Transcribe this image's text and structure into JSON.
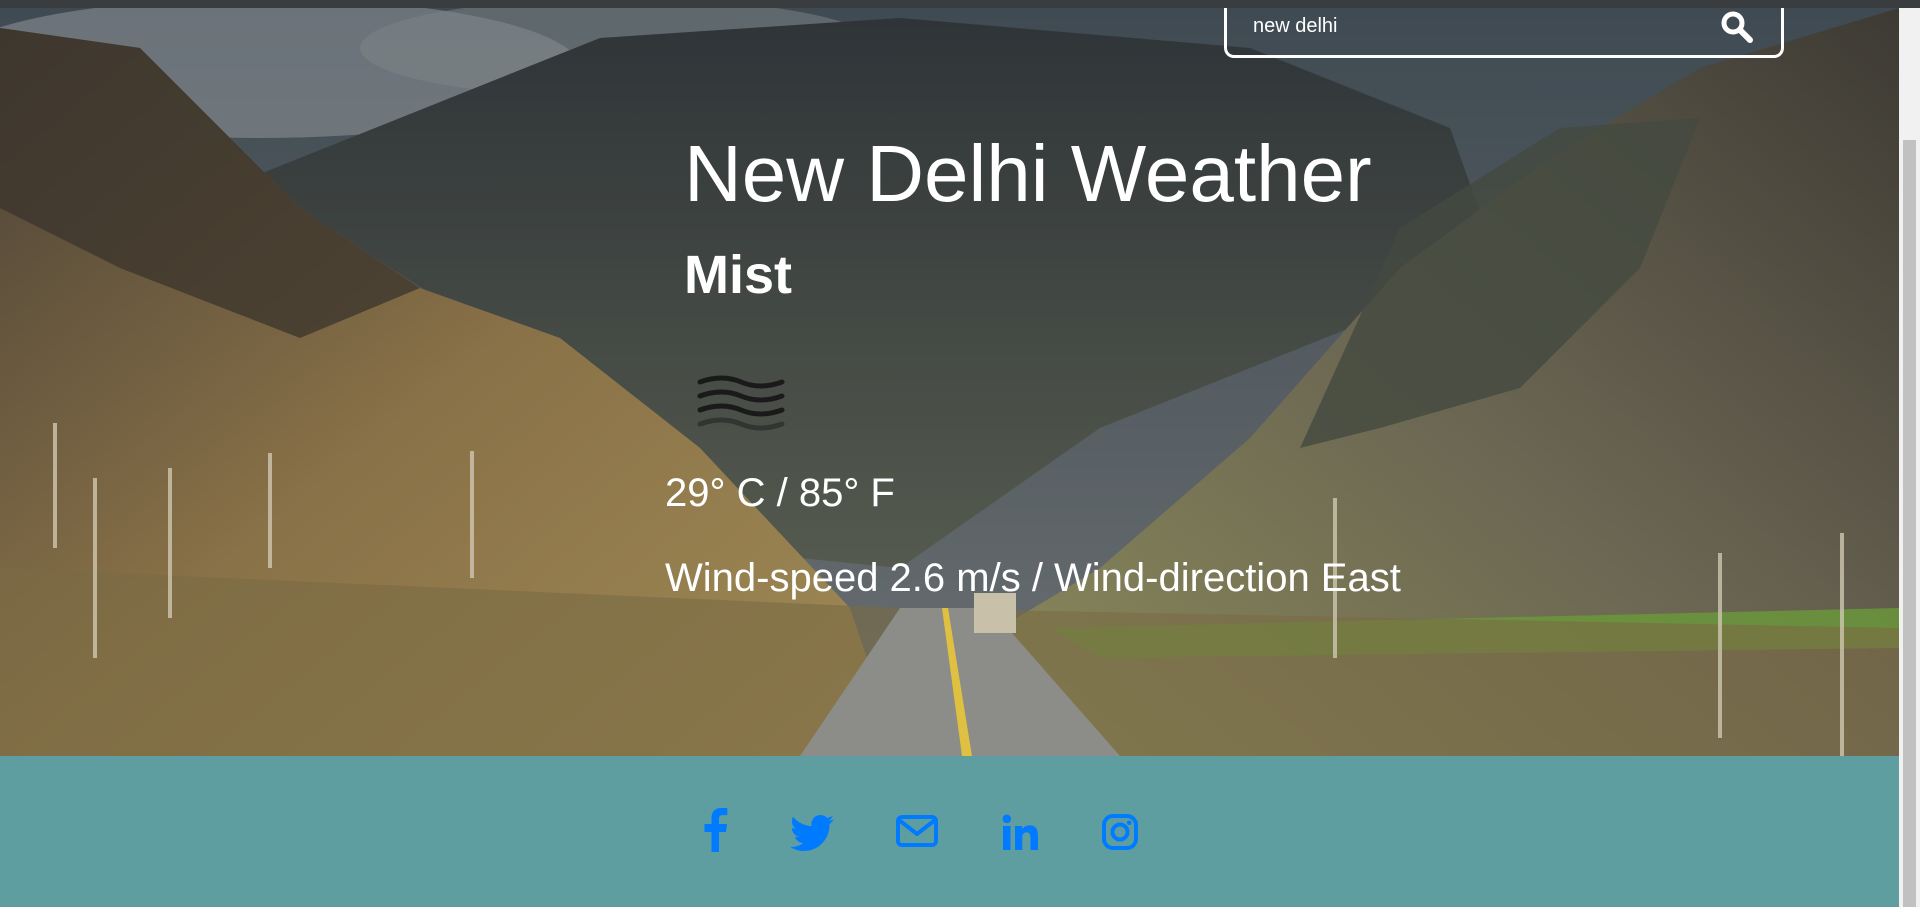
{
  "search": {
    "value": "new delhi"
  },
  "weather": {
    "title": "New Delhi Weather",
    "condition": "Mist",
    "condition_icon": "mist-icon",
    "temperature": "29° C / 85° F",
    "wind": "Wind-speed 2.6 m/s / Wind-direction East"
  },
  "footer": {
    "icons": [
      "facebook-icon",
      "twitter-icon",
      "mail-icon",
      "linkedin-icon",
      "instagram-icon"
    ],
    "icon_color": "#007bff",
    "background": "#5f9ea0"
  }
}
